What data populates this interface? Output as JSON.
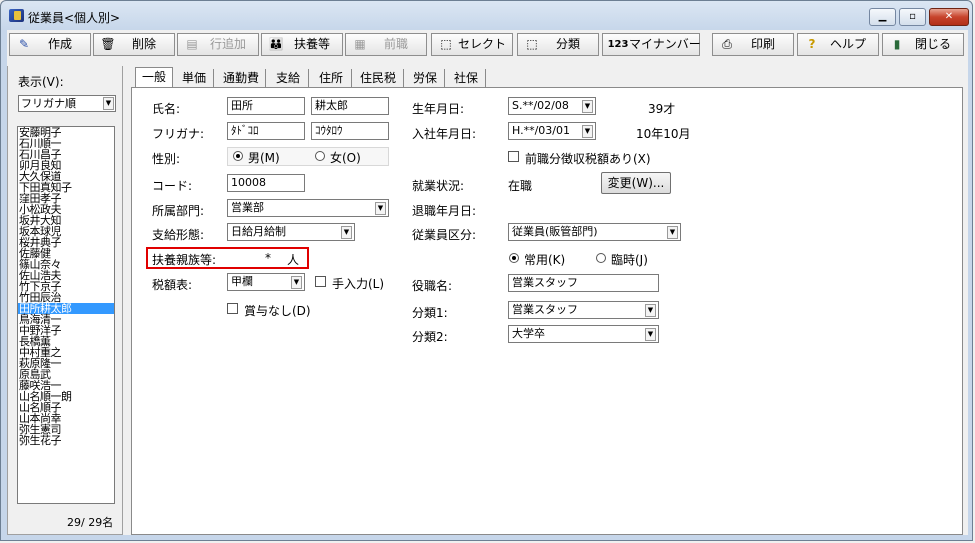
{
  "window": {
    "title": "従業員<個人別>"
  },
  "toolbar": {
    "create": "作成",
    "delete": "削除",
    "add_row": "行追加",
    "dependents": "扶養等",
    "prev_job": "前職",
    "select": "セレクト",
    "classify": "分類",
    "mynumber": "マイナンバー",
    "print": "印刷",
    "help": "ヘルプ",
    "close": "閉じる"
  },
  "left": {
    "display_label": "表示(V):",
    "sort_value": "フリガナ順",
    "employees": [
      "安藤明子",
      "石川順一",
      "石川昌子",
      "卯月良知",
      "大久保道",
      "下田真知子",
      "窪田孝子",
      "小松政夫",
      "坂井大知",
      "坂本球児",
      "桜井典子",
      "佐藤健",
      "篠山奈々",
      "佐山浩夫",
      "竹下京子",
      "竹田辰治",
      "田所耕太郎",
      "鳥海清一",
      "中野洋子",
      "長橋薫",
      "中村重之",
      "萩原隆一",
      "原島武",
      "藤咲浩一",
      "山名順一朗",
      "山名順子",
      "山本尚幸",
      "弥生憲司",
      "弥生花子"
    ],
    "selected_index": 16,
    "count": "29/ 29名"
  },
  "tabs": [
    "一般",
    "単価",
    "通勤費",
    "支給",
    "住所",
    "住民税",
    "労保",
    "社保"
  ],
  "form": {
    "name_label": "氏名:",
    "last_name": "田所",
    "first_name": "耕太郎",
    "furigana_label": "フリガナ:",
    "last_kana": "ﾀﾄﾞｺﾛ",
    "first_kana": "ｺｳﾀﾛｳ",
    "gender_label": "性別:",
    "male": "男(M)",
    "female": "女(O)",
    "code_label": "コード:",
    "code": "10008",
    "dept_label": "所属部門:",
    "dept": "営業部",
    "pay_label": "支給形態:",
    "pay": "日給月給制",
    "dependents_label": "扶養親族等:",
    "dependents_value": "*",
    "dependents_unit": "人",
    "tax_label": "税額表:",
    "tax": "甲欄",
    "manual_input": "手入力(L)",
    "no_bonus": "賞与なし(D)",
    "birth_label": "生年月日:",
    "birth": "S.**/02/08",
    "age": "39才",
    "hire_label": "入社年月日:",
    "hire": "H.**/03/01",
    "tenure": "10年10月",
    "prev_tax": "前職分徴収税額あり(X)",
    "status_label": "就業状況:",
    "status": "在職",
    "change_button": "変更(W)...",
    "retire_label": "退職年月日:",
    "emp_type_label": "従業員区分:",
    "emp_type": "従業員(販管部門)",
    "regular": "常用(K)",
    "temp": "臨時(J)",
    "position_label": "役職名:",
    "position": "営業スタッフ",
    "class1_label": "分類1:",
    "class1": "営業スタッフ",
    "class2_label": "分類2:",
    "class2": "大学卒"
  }
}
